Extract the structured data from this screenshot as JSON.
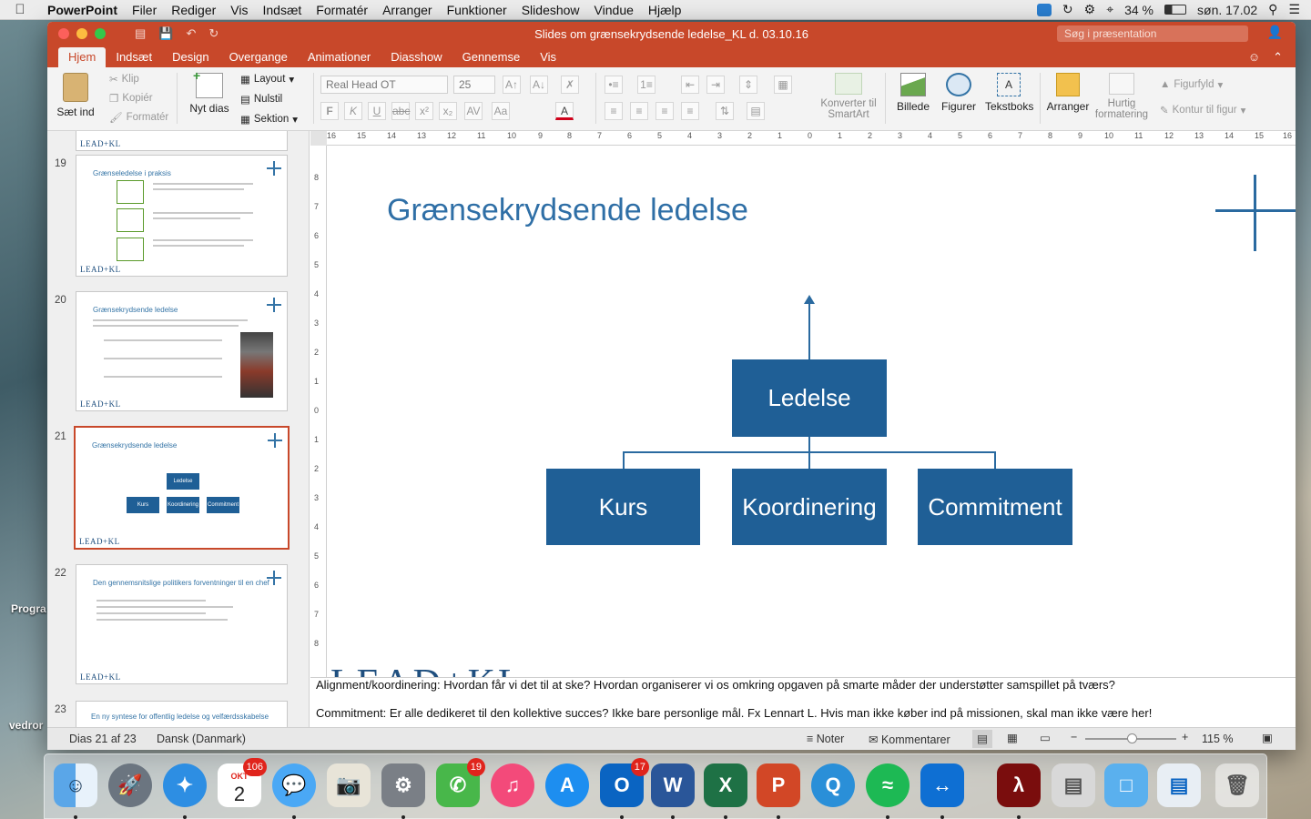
{
  "menubar": {
    "app": "PowerPoint",
    "items": [
      "Filer",
      "Rediger",
      "Vis",
      "Indsæt",
      "Formatér",
      "Arranger",
      "Funktioner",
      "Slideshow",
      "Vindue",
      "Hjælp"
    ],
    "battery": "34 %",
    "clock": "søn. 17.02"
  },
  "window": {
    "title": "Slides om grænsekrydsende ledelse_KL d. 03.10.16",
    "search_placeholder": "Søg i præsentation"
  },
  "tabs": [
    "Hjem",
    "Indsæt",
    "Design",
    "Overgange",
    "Animationer",
    "Diasshow",
    "Gennemse",
    "Vis"
  ],
  "ribbon": {
    "paste": "Sæt ind",
    "cut": "Klip",
    "copy": "Kopiér",
    "format": "Formatér",
    "new_slide": "Nyt dias",
    "layout": "Layout",
    "reset": "Nulstil",
    "section": "Sektion",
    "font": "Real Head OT",
    "size": "25",
    "convert": "Konverter til SmartArt",
    "picture": "Billede",
    "shapes": "Figurer",
    "textbox": "Tekstboks",
    "arrange": "Arranger",
    "quick_styles": "Hurtig formatering",
    "shape_fill": "Figurfyld",
    "shape_outline": "Kontur til figur"
  },
  "thumbnails": [
    {
      "num": "19",
      "title": "Grænseledelse i praksis"
    },
    {
      "num": "20",
      "title": "Grænsekrydsende ledelse"
    },
    {
      "num": "21",
      "title": "Grænsekrydsende ledelse"
    },
    {
      "num": "22",
      "title": "Den gennemsnitslige politikers forventninger til en chef"
    },
    {
      "num": "23",
      "title": "En ny syntese for offentlig ledelse og velfærdsskabelse"
    }
  ],
  "thumb_logo": "LEAD+KL",
  "slide": {
    "title": "Grænsekrydsende ledelse",
    "root": "Ledelse",
    "children": [
      "Kurs",
      "Koordinering",
      "Commitment"
    ],
    "logo": "LEAD+KL"
  },
  "notes": {
    "line1": "Alignment/koordinering: Hvordan får vi det til at ske? Hvordan organiserer vi os omkring opgaven på smarte måder der understøtter samspillet på tværs?",
    "line2": "Commitment: Er alle dedikeret til den kollektive succes? Ikke bare personlige mål. Fx Lennart L. Hvis man ikke køber ind på missionen, skal man ikke være her!"
  },
  "status": {
    "slide_info": "Dias 21 af 23",
    "language": "Dansk (Danmark)",
    "notes": "Noter",
    "comments": "Kommentarer",
    "zoom": "115 %"
  },
  "dock": {
    "calendar_month": "OKT",
    "calendar_day": "2",
    "calendar_badge": "106",
    "facetime_badge": "19",
    "outlook_badge": "17"
  },
  "desktop": {
    "label1": "Progra",
    "label2": "T",
    "label3": "vedror"
  }
}
